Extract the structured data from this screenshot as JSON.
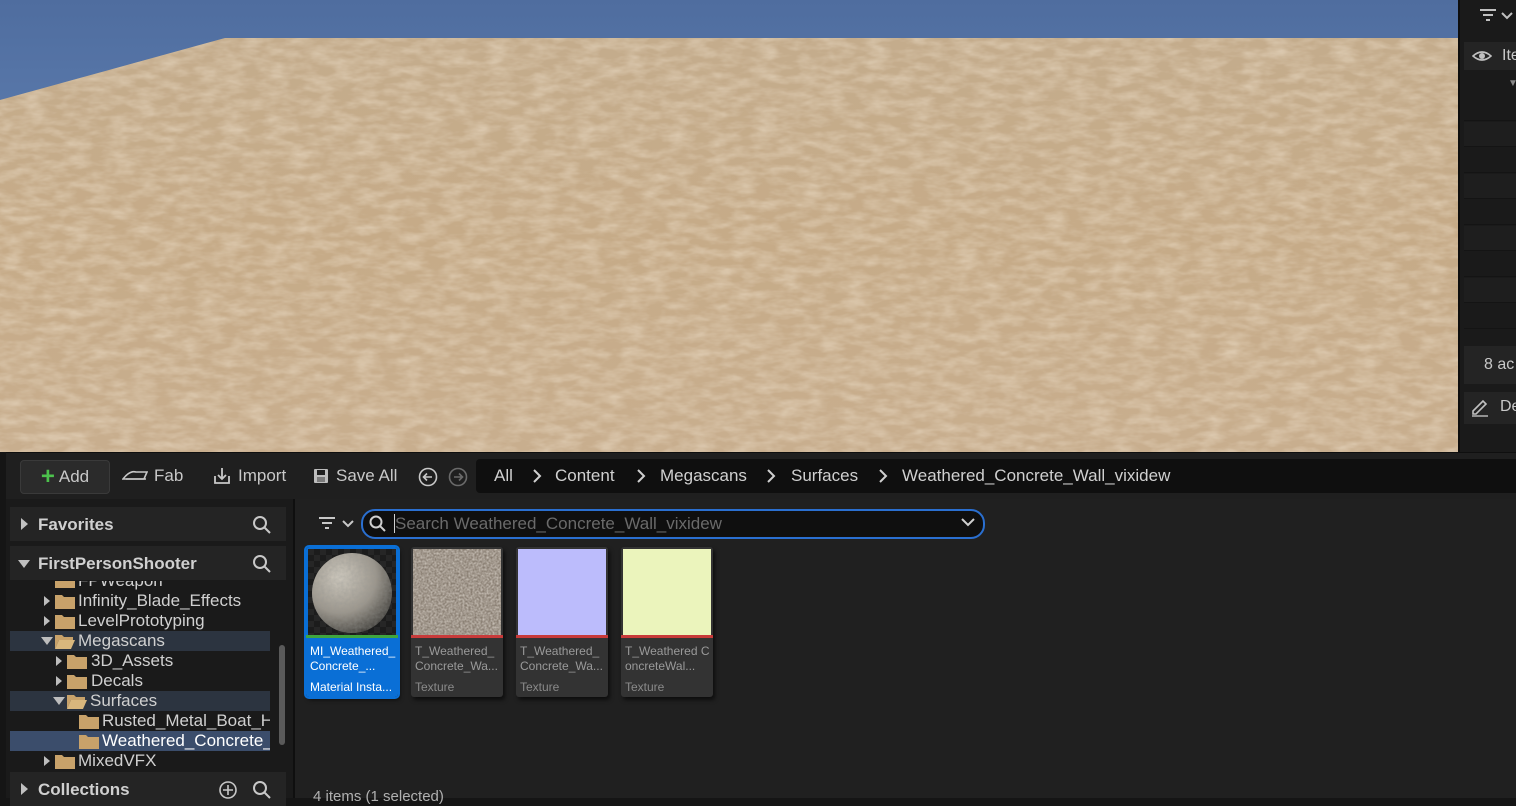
{
  "outliner": {
    "header_label": "Ite",
    "status_label": "8 ac",
    "details_label": "De"
  },
  "toolbar": {
    "add_label": "Add",
    "fab_label": "Fab",
    "import_label": "Import",
    "save_all_label": "Save All"
  },
  "breadcrumb": [
    "All",
    "Content",
    "Megascans",
    "Surfaces",
    "Weathered_Concrete_Wall_vixidew"
  ],
  "tree": {
    "favorites_label": "Favorites",
    "project_label": "FirstPersonShooter",
    "collections_label": "Collections",
    "items": [
      {
        "label": "FPWeapon"
      },
      {
        "label": "Infinity_Blade_Effects"
      },
      {
        "label": "LevelPrototyping"
      },
      {
        "label": "Megascans"
      },
      {
        "label": "3D_Assets"
      },
      {
        "label": "Decals"
      },
      {
        "label": "Surfaces"
      },
      {
        "label": "Rusted_Metal_Boat_H"
      },
      {
        "label": "Weathered_Concrete_"
      },
      {
        "label": "MixedVFX"
      }
    ]
  },
  "search": {
    "placeholder": "Search Weathered_Concrete_Wall_vixidew"
  },
  "assets": [
    {
      "title": "MI_Weathered_Concrete_...",
      "type": "Material Insta...",
      "bar_color": "#3fa63f",
      "thumb": "sphere"
    },
    {
      "title": "T_Weathered_Concrete_Wa...",
      "type": "Texture",
      "bar_color": "#c83a3a",
      "thumb_color": "#8a7e72"
    },
    {
      "title": "T_Weathered_Concrete_Wa...",
      "type": "Texture",
      "bar_color": "#c83a3a",
      "thumb_color": "#bcbcfc"
    },
    {
      "title": "T_Weathered ConcreteWal...",
      "type": "Texture",
      "bar_color": "#c83a3a",
      "thumb_color": "#ebf4bc"
    }
  ],
  "status": {
    "count_label": "4 items (1 selected)"
  },
  "colors": {
    "accent": "#0a6fd6",
    "add_green": "#4cc24c"
  }
}
